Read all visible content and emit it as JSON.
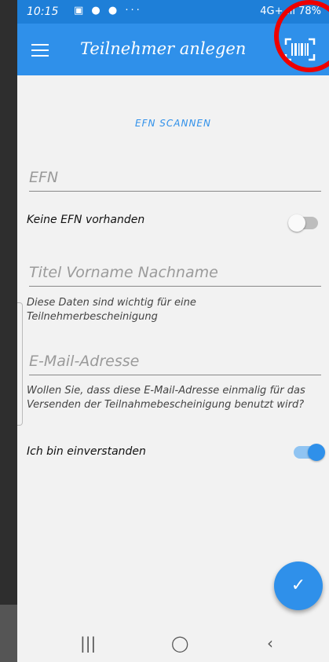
{
  "status_bar": {
    "time": "10:15",
    "icons": "▣ ● ● ···",
    "network": "4G+ .ıl",
    "battery": "78%"
  },
  "app_bar": {
    "title": "Teilnehmer anlegen",
    "menu_icon": "hamburger-menu-icon",
    "scan_icon": "barcode-scan-icon"
  },
  "form": {
    "scan_link": "EFN SCANNEN",
    "efn_placeholder": "EFN",
    "no_efn_label": "Keine EFN vorhanden",
    "no_efn_toggle": false,
    "name_placeholder": "Titel Vorname Nachname",
    "name_helper": "Diese Daten sind wichtig für eine Teilnehmerbescheinigung",
    "email_placeholder": "E-Mail-Adresse",
    "email_helper": "Wollen Sie, dass diese E-Mail-Adresse einmalig für das Versenden der Teilnahmebescheinigung benutzt wird?",
    "consent_label": "Ich bin einverstanden",
    "consent_toggle": true
  },
  "fab": {
    "icon": "checkmark-icon",
    "glyph": "✓"
  },
  "nav_bar": {
    "recent": "|||",
    "home": "◯",
    "back": "‹"
  },
  "colors": {
    "primary": "#2f90ea",
    "status_bar": "#1e7fd8",
    "annotation": "#e00000"
  }
}
